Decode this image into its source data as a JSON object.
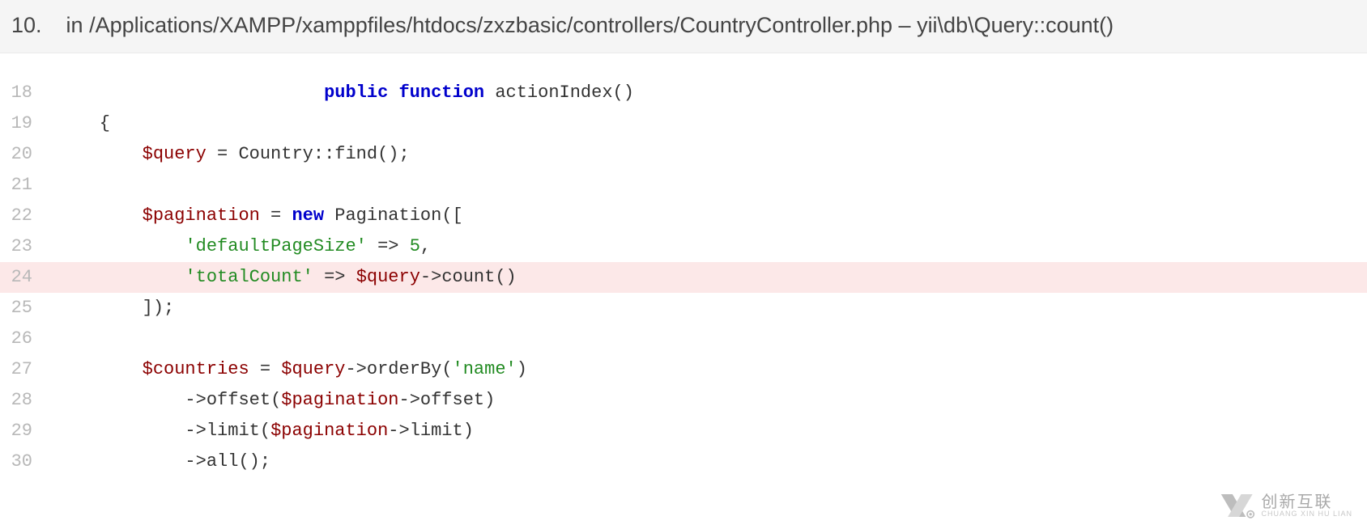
{
  "header": {
    "trace_number": "10.",
    "in_label": "in ",
    "file_path": "/Applications/XAMPP/xamppfiles/htdocs/zxzbasic/controllers/CountryController.php",
    "separator": " – ",
    "method_call": "yii\\db\\Query::count()"
  },
  "code": {
    "lines": [
      {
        "num": "18",
        "highlighted": false,
        "tokens": [
          {
            "t": "plain",
            "v": "                         "
          },
          {
            "t": "kw",
            "v": "public"
          },
          {
            "t": "plain",
            "v": " "
          },
          {
            "t": "kw",
            "v": "function"
          },
          {
            "t": "plain",
            "v": " "
          },
          {
            "t": "fn",
            "v": "actionIndex"
          },
          {
            "t": "plain",
            "v": "()"
          }
        ]
      },
      {
        "num": "19",
        "highlighted": false,
        "tokens": [
          {
            "t": "plain",
            "v": "    {"
          }
        ]
      },
      {
        "num": "20",
        "highlighted": false,
        "tokens": [
          {
            "t": "plain",
            "v": "        "
          },
          {
            "t": "var",
            "v": "$query"
          },
          {
            "t": "plain",
            "v": " = "
          },
          {
            "t": "cls",
            "v": "Country"
          },
          {
            "t": "plain",
            "v": "::"
          },
          {
            "t": "fn",
            "v": "find"
          },
          {
            "t": "plain",
            "v": "();"
          }
        ]
      },
      {
        "num": "21",
        "highlighted": false,
        "tokens": []
      },
      {
        "num": "22",
        "highlighted": false,
        "tokens": [
          {
            "t": "plain",
            "v": "        "
          },
          {
            "t": "var",
            "v": "$pagination"
          },
          {
            "t": "plain",
            "v": " = "
          },
          {
            "t": "kw",
            "v": "new"
          },
          {
            "t": "plain",
            "v": " "
          },
          {
            "t": "cls",
            "v": "Pagination"
          },
          {
            "t": "plain",
            "v": "(["
          }
        ]
      },
      {
        "num": "23",
        "highlighted": false,
        "tokens": [
          {
            "t": "plain",
            "v": "            "
          },
          {
            "t": "str",
            "v": "'defaultPageSize'"
          },
          {
            "t": "plain",
            "v": " => "
          },
          {
            "t": "num",
            "v": "5"
          },
          {
            "t": "plain",
            "v": ","
          }
        ]
      },
      {
        "num": "24",
        "highlighted": true,
        "tokens": [
          {
            "t": "plain",
            "v": "            "
          },
          {
            "t": "str",
            "v": "'totalCount'"
          },
          {
            "t": "plain",
            "v": " => "
          },
          {
            "t": "var",
            "v": "$query"
          },
          {
            "t": "plain",
            "v": "->"
          },
          {
            "t": "fn",
            "v": "count"
          },
          {
            "t": "plain",
            "v": "()"
          }
        ]
      },
      {
        "num": "25",
        "highlighted": false,
        "tokens": [
          {
            "t": "plain",
            "v": "        ]);"
          }
        ]
      },
      {
        "num": "26",
        "highlighted": false,
        "tokens": []
      },
      {
        "num": "27",
        "highlighted": false,
        "tokens": [
          {
            "t": "plain",
            "v": "        "
          },
          {
            "t": "var",
            "v": "$countries"
          },
          {
            "t": "plain",
            "v": " = "
          },
          {
            "t": "var",
            "v": "$query"
          },
          {
            "t": "plain",
            "v": "->"
          },
          {
            "t": "fn",
            "v": "orderBy"
          },
          {
            "t": "plain",
            "v": "("
          },
          {
            "t": "str",
            "v": "'name'"
          },
          {
            "t": "plain",
            "v": ")"
          }
        ]
      },
      {
        "num": "28",
        "highlighted": false,
        "tokens": [
          {
            "t": "plain",
            "v": "            ->"
          },
          {
            "t": "fn",
            "v": "offset"
          },
          {
            "t": "plain",
            "v": "("
          },
          {
            "t": "var",
            "v": "$pagination"
          },
          {
            "t": "plain",
            "v": "->offset)"
          }
        ]
      },
      {
        "num": "29",
        "highlighted": false,
        "tokens": [
          {
            "t": "plain",
            "v": "            ->"
          },
          {
            "t": "fn",
            "v": "limit"
          },
          {
            "t": "plain",
            "v": "("
          },
          {
            "t": "var",
            "v": "$pagination"
          },
          {
            "t": "plain",
            "v": "->limit)"
          }
        ]
      },
      {
        "num": "30",
        "highlighted": false,
        "tokens": [
          {
            "t": "plain",
            "v": "            ->"
          },
          {
            "t": "fn",
            "v": "all"
          },
          {
            "t": "plain",
            "v": "();"
          }
        ]
      }
    ]
  },
  "watermark": {
    "main": "创新互联",
    "sub": "CHUANG XIN HU LIAN"
  }
}
